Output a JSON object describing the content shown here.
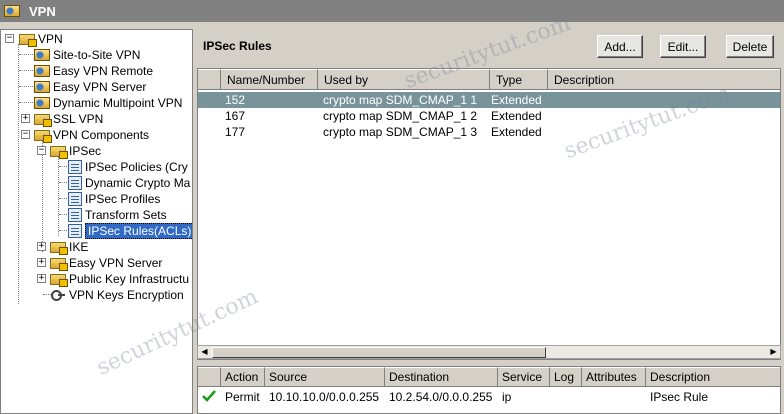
{
  "window": {
    "title": "VPN",
    "icon": "vpn-folder-icon"
  },
  "tree": {
    "root": "VPN",
    "items": [
      "Site-to-Site VPN",
      "Easy VPN Remote",
      "Easy VPN Server",
      "Dynamic Multipoint VPN",
      "SSL VPN",
      "VPN Components",
      "IPSec",
      "IPSec Policies (Cry",
      "Dynamic Crypto Ma",
      "IPSec Profiles",
      "Transform Sets",
      "IPSec Rules(ACLs)",
      "IKE",
      "Easy VPN Server",
      "Public Key Infrastructu",
      "VPN Keys Encryption"
    ],
    "expand_plus": "+",
    "expand_minus": "−"
  },
  "panel": {
    "title": "IPSec Rules",
    "buttons": {
      "add": "Add...",
      "edit": "Edit...",
      "delete": "Delete"
    }
  },
  "rules_table": {
    "columns": [
      "Name/Number",
      "Used by",
      "Type",
      "Description"
    ],
    "rows": [
      {
        "name": "152",
        "used_by": "crypto map SDM_CMAP_1 1",
        "type": "Extended",
        "description": ""
      },
      {
        "name": "167",
        "used_by": "crypto map SDM_CMAP_1 2",
        "type": "Extended",
        "description": ""
      },
      {
        "name": "177",
        "used_by": "crypto map SDM_CMAP_1 3",
        "type": "Extended",
        "description": ""
      }
    ],
    "selected_row": 0
  },
  "detail_table": {
    "columns": [
      "Action",
      "Source",
      "Destination",
      "Service",
      "Log",
      "Attributes",
      "Description"
    ],
    "rows": [
      {
        "action": "Permit",
        "source": "10.10.10.0/0.0.0.255",
        "destination": "10.2.54.0/0.0.0.255",
        "service": "ip",
        "log": "",
        "attributes": "",
        "description": "IPsec Rule"
      }
    ]
  },
  "watermark": "securitytut.com",
  "colors": {
    "selection": "#316ac5",
    "row_selected": "#78949a",
    "permit_check": "#1a9a1a"
  }
}
